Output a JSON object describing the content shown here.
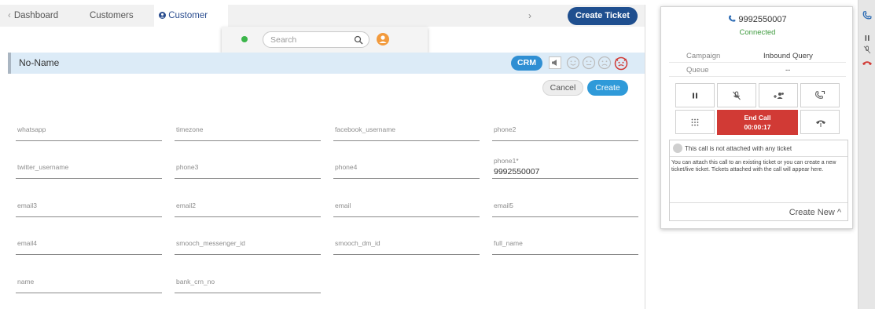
{
  "tabs": {
    "dashboard": "Dashboard",
    "customers": "Customers",
    "customer": "Customer",
    "create_ticket": "Create Ticket"
  },
  "search": {
    "placeholder": "Search",
    "status_color": "#3bb54a"
  },
  "contact": {
    "name": "No-Name",
    "crm_label": "CRM",
    "cancel_label": "Cancel",
    "create_label": "Create"
  },
  "fields": [
    {
      "label": "whatsapp",
      "value": ""
    },
    {
      "label": "timezone",
      "value": ""
    },
    {
      "label": "facebook_username",
      "value": ""
    },
    {
      "label": "phone2",
      "value": ""
    },
    {
      "label": "twitter_username",
      "value": ""
    },
    {
      "label": "phone3",
      "value": ""
    },
    {
      "label": "phone4",
      "value": ""
    },
    {
      "label": "phone1*",
      "value": "9992550007"
    },
    {
      "label": "email3",
      "value": ""
    },
    {
      "label": "email2",
      "value": ""
    },
    {
      "label": "email",
      "value": ""
    },
    {
      "label": "email5",
      "value": ""
    },
    {
      "label": "email4",
      "value": ""
    },
    {
      "label": "smooch_messenger_id",
      "value": ""
    },
    {
      "label": "smooch_dm_id",
      "value": ""
    },
    {
      "label": "full_name",
      "value": ""
    },
    {
      "label": "name",
      "value": ""
    },
    {
      "label": "bank_crn_no",
      "value": ""
    }
  ],
  "call": {
    "phone": "9992550007",
    "status": "Connected",
    "campaign_label": "Campaign",
    "campaign_value": "Inbound Query",
    "queue_label": "Queue",
    "queue_value": "--",
    "end_call_label": "End Call",
    "timer": "00:00:17",
    "notice_title": "This call is not attached with any ticket",
    "notice_body": "You can attach this call to an existing ticket or you can create a new ticket/live ticket. Tickets attached with the call will appear here.",
    "create_new_label": "Create New ^",
    "end_call_color": "#d13a35",
    "status_color": "#3e9a3e"
  },
  "colors": {
    "accent": "#1f4f8f",
    "crm": "#2f8fd3",
    "contact_bar": "#dcebf7"
  }
}
